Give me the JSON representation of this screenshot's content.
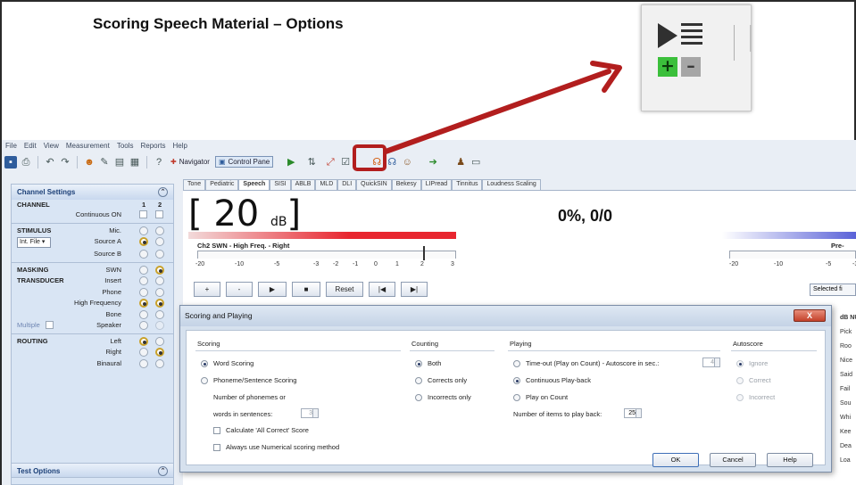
{
  "slide_title": "Scoring Speech Material – Options",
  "annotation": {
    "arrow_color": "#b21e1e",
    "highlight_color": "#b21e1e",
    "zoom_icons": [
      "play-icon",
      "list-icon",
      "plus-icon",
      "minus-icon"
    ]
  },
  "zoom": {
    "plus": "+",
    "minus": "–"
  },
  "menubar": [
    "File",
    "Edit",
    "View",
    "Measurement",
    "Tools",
    "Reports",
    "Help"
  ],
  "toolbar": {
    "navigator": "Navigator",
    "control_panel": "Control Pane"
  },
  "channel_settings": {
    "title": "Channel Settings",
    "col1": "1",
    "col2": "2",
    "channel": "CHANNEL",
    "continuous_on": "Continuous ON",
    "stimulus": "STIMULUS",
    "mic": "Mic.",
    "source_a": "Source A",
    "source_b": "Source B",
    "int_file": "Int. File",
    "masking": "MASKING",
    "swn": "SWN",
    "transducer": "TRANSDUCER",
    "insert": "Insert",
    "phone": "Phone",
    "high_frequency": "High Frequency",
    "bone": "Bone",
    "speaker": "Speaker",
    "multiple": "Multiple",
    "routing": "ROUTING",
    "left": "Left",
    "right": "Right",
    "binaural": "Binaural"
  },
  "test_options": "Test Options",
  "tabs": [
    "Tone",
    "Pediatric",
    "Speech",
    "SISI",
    "ABLB",
    "MLD",
    "DLI",
    "QuickSIN",
    "Bekesy",
    "LIPread",
    "Tinnitus",
    "Loudness Scaling"
  ],
  "active_tab": "Speech",
  "level": {
    "value": "20",
    "unit": "dB",
    "open": "[",
    "close": "]"
  },
  "score": "0%, 0/0",
  "channel_label": "Ch2  SWN - High Freq. - Right",
  "pre_label": "Pre-",
  "ticks_left": [
    "-20",
    "-10",
    "-5",
    "-3",
    "-2",
    "-1",
    "0",
    "1",
    "2",
    "3"
  ],
  "ticks_right": [
    "-20",
    "-10",
    "-5",
    "-3"
  ],
  "controls": {
    "plus": "+",
    "minus": "-",
    "play": "▶",
    "stop": "■",
    "reset": "Reset",
    "prev": "|◀",
    "next": "▶|"
  },
  "selected_box": "Selected fi",
  "word_list": {
    "header": "dB NU",
    "items": [
      "Pick",
      "Roo",
      "Nice",
      "Said",
      "Fail",
      "Sou",
      "Whi",
      "Kee",
      "Dea",
      "Loa"
    ]
  },
  "dialog": {
    "title": "Scoring and Playing",
    "close": "X",
    "scoring": {
      "heading": "Scoring",
      "word_scoring": "Word Scoring",
      "phoneme": "Phoneme/Sentence Scoring",
      "num_phonemes": "Number of phonemes or",
      "words_in_sentences": "words in sentences:",
      "num_value": "3",
      "calc_all_correct": "Calculate 'All Correct' Score",
      "always_numerical": "Always use Numerical scoring method"
    },
    "counting": {
      "heading": "Counting",
      "both": "Both",
      "corrects_only": "Corrects only",
      "incorrects_only": "Incorrects only"
    },
    "playing": {
      "heading": "Playing",
      "timeout": "Time-out (Play on Count)  -  Autoscore in sec.:",
      "timeout_value": "4",
      "continuous": "Continuous Play-back",
      "play_on_count": "Play on Count",
      "items_to_play": "Number of items to play back:",
      "items_value": "25"
    },
    "autoscore": {
      "heading": "Autoscore",
      "ignore": "Ignore",
      "correct": "Correct",
      "incorrect": "Incorrect"
    },
    "buttons": {
      "ok": "OK",
      "cancel": "Cancel",
      "help": "Help"
    }
  }
}
